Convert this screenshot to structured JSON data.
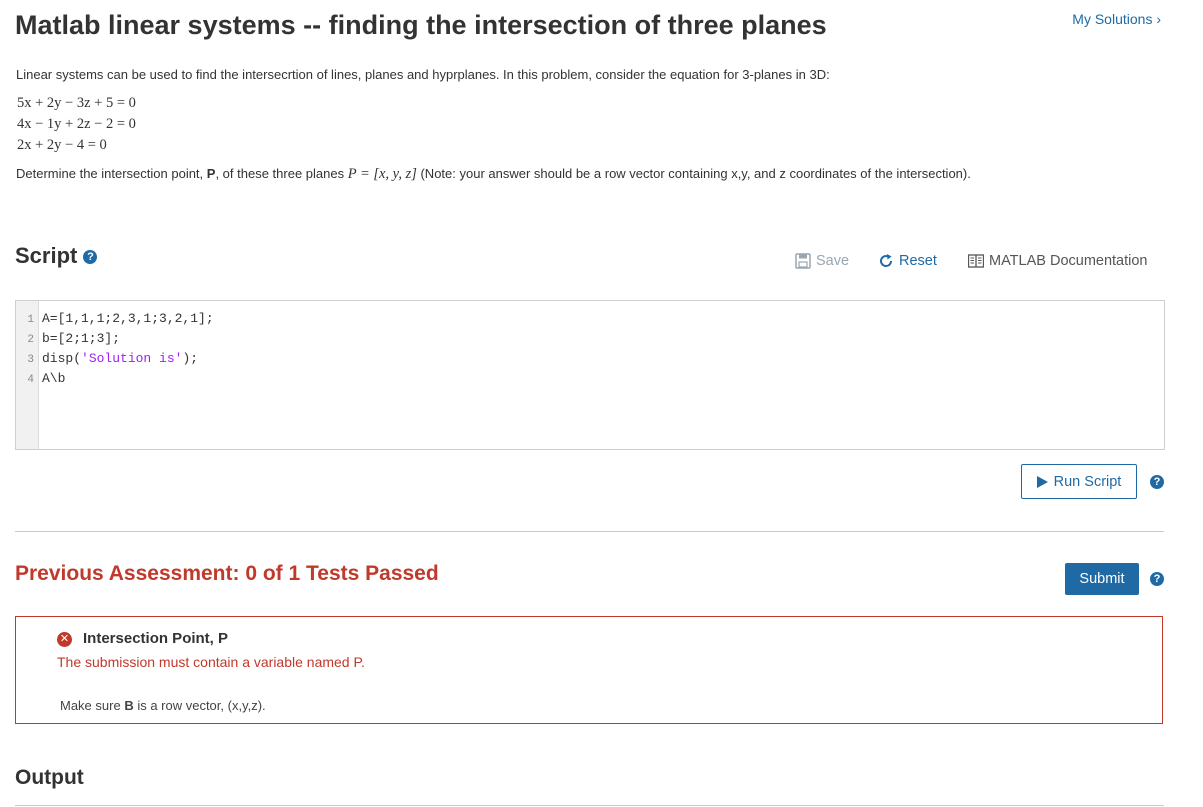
{
  "page": {
    "title": "Matlab linear systems -- finding the intersection of three planes",
    "my_solutions": "My Solutions ›"
  },
  "problem": {
    "intro": "Linear systems can be used to find the intersecrtion of lines, planes and hyprplanes. In this problem, consider the equation for 3-planes in 3D:",
    "equations": [
      "5x + 2y − 3z + 5 = 0",
      "4x − 1y + 2z − 2 = 0",
      "2x + 2y − 4 = 0"
    ],
    "task_prefix": "Determine the intersection point, ",
    "task_var": "P",
    "task_mid": ", of these three planes ",
    "task_formula": "P = [x, y, z]",
    "task_suffix": " (Note: your answer should be a row vector  containing x,y, and z coordinates of the intersection)."
  },
  "script": {
    "heading": "Script",
    "help": "?",
    "toolbar": {
      "save": "Save",
      "reset": "Reset",
      "docs": "MATLAB Documentation"
    },
    "code_lines": [
      {
        "n": "1",
        "code": "A=[1,1,1;2,3,1;3,2,1];"
      },
      {
        "n": "2",
        "code": "b=[2;1;3];"
      },
      {
        "n": "3",
        "pre": "disp(",
        "str": "'Solution is'",
        "post": ");"
      },
      {
        "n": "4",
        "code": "A\\b"
      }
    ],
    "run_label": "Run Script"
  },
  "assessment": {
    "heading": "Previous Assessment: 0 of 1 Tests Passed",
    "submit_label": "Submit",
    "test": {
      "title": "Intersection Point, P",
      "message": "The submission must contain a variable named P.",
      "hint_prefix": "Make sure ",
      "hint_bold": "B",
      "hint_suffix": " is a row vector, (x,y,z)."
    }
  },
  "output": {
    "heading": "Output"
  },
  "colors": {
    "accent": "#1f6aa5",
    "error": "#c0392b"
  }
}
